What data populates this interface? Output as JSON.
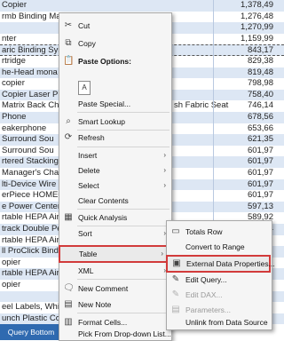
{
  "rows": [
    {
      "name": "Copier",
      "value": "1,378,49",
      "band": "a"
    },
    {
      "name": "rmb Binding Machine",
      "value": "1,276,48",
      "band": "b"
    },
    {
      "name": "",
      "value": "1,270,99",
      "band": "a"
    },
    {
      "name": "nter",
      "value": "1,159,99",
      "band": "b"
    },
    {
      "name": "aric Binding Syst",
      "value": "843,17",
      "band": "a"
    },
    {
      "name": "rtridge",
      "value": "829,38",
      "band": "b"
    },
    {
      "name": "he-Head mona",
      "value": "819,48",
      "band": "a"
    },
    {
      "name": "copier",
      "value": "798,98",
      "band": "b"
    },
    {
      "name": "Copier Laser P",
      "value": "758,40",
      "band": "a"
    },
    {
      "name": "Matrix Back Cha",
      "value": "746,14",
      "band": "b"
    },
    {
      "name": "Phone",
      "value": "678,56",
      "band": "a"
    },
    {
      "name": "eakerphone",
      "value": "653,66",
      "band": "b"
    },
    {
      "name": "Surround Sou",
      "value": "621,35",
      "band": "a"
    },
    {
      "name": "Surround Sou",
      "value": "601,97",
      "band": "b"
    },
    {
      "name": "rtered Stacking",
      "value": "601,97",
      "band": "a"
    },
    {
      "name": "Manager's Chai",
      "value": "601,97",
      "band": "b"
    },
    {
      "name": "lti-Device Wire",
      "value": "601,97",
      "band": "a"
    },
    {
      "name": "erPiece HOMEC",
      "value": "601,97",
      "band": "b"
    },
    {
      "name": "e Power Center",
      "value": "597,13",
      "band": "a"
    },
    {
      "name": "rtable HEPA Air",
      "value": "589,92",
      "band": "b"
    },
    {
      "name": "track Double Pe",
      "value": "574,24",
      "band": "a"
    },
    {
      "name": "rtable HEPA Air",
      "value": "",
      "band": "b"
    },
    {
      "name": "ll ProClick Bindi",
      "value": "",
      "band": "a"
    },
    {
      "name": "opier",
      "value": "",
      "band": "b"
    },
    {
      "name": "rtable HEPA Air",
      "value": "",
      "band": "a"
    },
    {
      "name": "opier",
      "value": "",
      "band": "b"
    },
    {
      "name": "",
      "value": "",
      "band": "a"
    },
    {
      "name": "eel Labels, Whi",
      "value": "",
      "band": "b"
    },
    {
      "name": "unch Plastic Co",
      "value": "",
      "band": "a"
    }
  ],
  "row_extra_text": {
    "matrix_row_suffix": "sh Fabric Seat"
  },
  "sheet_tab": "Query Bottom",
  "menu": {
    "cut": "Cut",
    "copy": "Copy",
    "paste_options": "Paste Options:",
    "paste_icon_glyph": "A",
    "paste_special": "Paste Special...",
    "smart_lookup": "Smart Lookup",
    "refresh": "Refresh",
    "insert": "Insert",
    "delete": "Delete",
    "select": "Select",
    "clear_contents": "Clear Contents",
    "quick_analysis": "Quick Analysis",
    "sort": "Sort",
    "filter": "Filter",
    "table": "Table",
    "xml": "XML",
    "new_comment": "New Comment",
    "new_note": "New Note",
    "format_cells": "Format Cells...",
    "pick_from_dropdown": "Pick From Drop-down List..."
  },
  "table_submenu": {
    "totals_row": "Totals Row",
    "convert_to_range": "Convert to Range",
    "external_data_properties": "External Data Properties...",
    "edit_query": "Edit Query...",
    "edit_dax": "Edit DAX...",
    "parameters": "Parameters...",
    "unlink_from_data_source": "Unlink from Data Source"
  },
  "colors": {
    "highlight_red": "#d23b3b",
    "band_blue": "#dde7f4",
    "tab_blue": "#2f6ab0"
  }
}
